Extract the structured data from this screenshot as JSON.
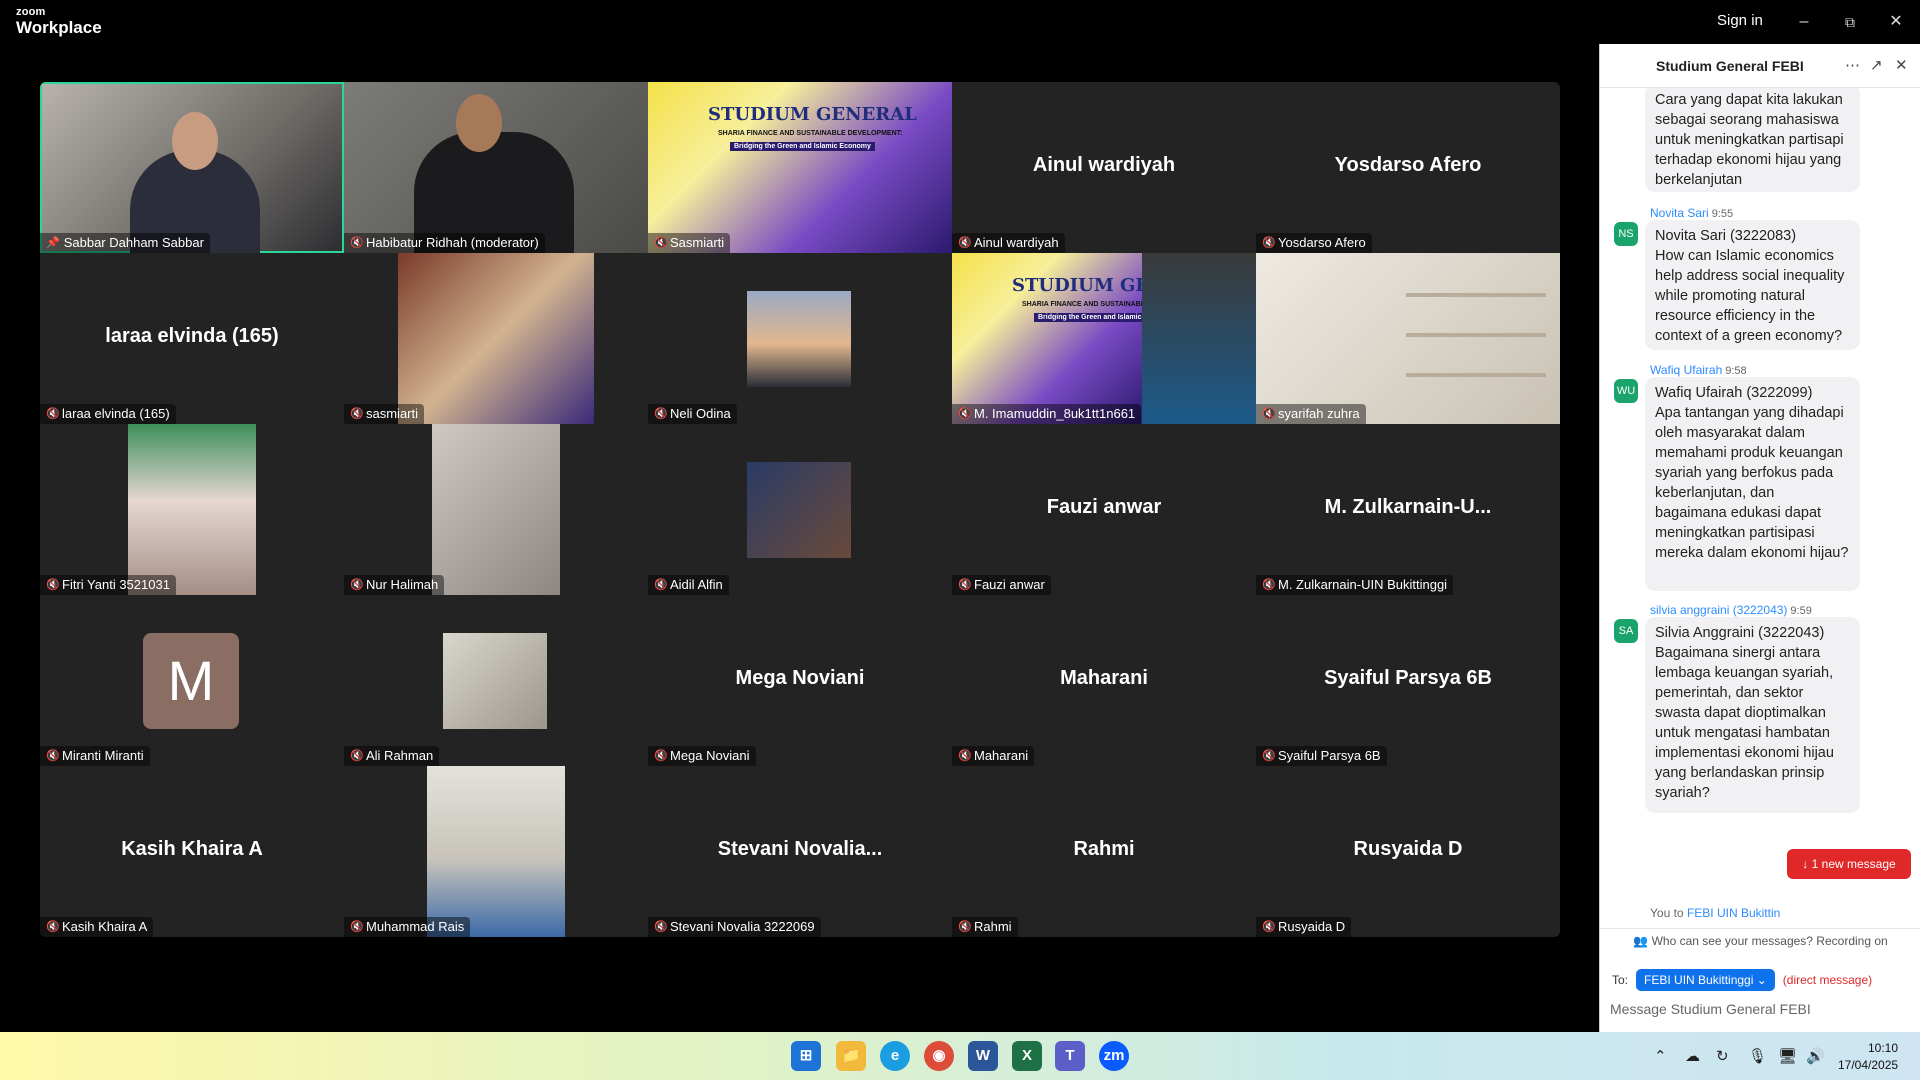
{
  "app": {
    "brand_top": "zoom",
    "brand_bottom": "Workplace",
    "signin": "Sign in"
  },
  "tiles": [
    {
      "name": "Sabbar Dahham Sabbar",
      "big": ""
    },
    {
      "name": "Habibatur Ridhah (moderator)",
      "big": ""
    },
    {
      "name": "Sasmiarti",
      "big": ""
    },
    {
      "name": "Ainul wardiyah",
      "big": "Ainul wardiyah"
    },
    {
      "name": "Yosdarso Afero",
      "big": "Yosdarso Afero"
    },
    {
      "name": "laraa elvinda (165)",
      "big": "laraa elvinda (165)"
    },
    {
      "name": "sasmiarti",
      "big": ""
    },
    {
      "name": "Neli Odina",
      "big": ""
    },
    {
      "name": "M. Imamuddin_8uk1tt1n661",
      "big": ""
    },
    {
      "name": "syarifah zuhra",
      "big": ""
    },
    {
      "name": "Fitri Yanti 3521031",
      "big": ""
    },
    {
      "name": "Nur Halimah",
      "big": ""
    },
    {
      "name": "Aidil Alfin",
      "big": ""
    },
    {
      "name": "Fauzi anwar",
      "big": "Fauzi anwar"
    },
    {
      "name": "M. Zulkarnain-UIN Bukittinggi",
      "big": "M.  Zulkarnain-U..."
    },
    {
      "name": "Miranti Miranti",
      "big": ""
    },
    {
      "name": "Ali Rahman",
      "big": ""
    },
    {
      "name": "Mega Noviani",
      "big": "Mega Noviani"
    },
    {
      "name": "Maharani",
      "big": "Maharani"
    },
    {
      "name": "Syaiful Parsya 6B",
      "big": "Syaiful Parsya 6B"
    },
    {
      "name": "Kasih Khaira A",
      "big": "Kasih Khaira A"
    },
    {
      "name": "Muhammad Rais",
      "big": ""
    },
    {
      "name": "Stevani Novalia 3222069",
      "big": "Stevani  Novalia..."
    },
    {
      "name": "Rahmi",
      "big": "Rahmi"
    },
    {
      "name": "Rusyaida D",
      "big": "Rusyaida D"
    }
  ],
  "avatar_letter": "M",
  "slide": {
    "title": "STUDIUM GENERAL",
    "subtitle": "SHARIA FINANCE AND SUSTAINABLE DEVELOPMENT:",
    "subtitle2": "Bridging the Green and Islamic Economy"
  },
  "chat": {
    "title": "Studium General FEBI",
    "first_bubble": "Cara yang dapat kita lakukan sebagai seorang mahasiswa untuk meningkatkan partisapi terhadap ekonomi hijau yang berkelanjutan",
    "messages": [
      {
        "initials": "NS",
        "sender": "Novita Sari",
        "time": "9:55",
        "text": "Novita Sari (3222083)\nHow can Islamic economics help address social inequality while promoting natural resource efficiency in the context of a green economy?"
      },
      {
        "initials": "WU",
        "sender": "Wafiq Ufairah",
        "time": "9:58",
        "text": "Wafiq Ufairah (3222099)\nApa tantangan yang dihadapi oleh masyarakat dalam memahami produk keuangan syariah yang berfokus pada keberlanjutan, dan bagaimana edukasi dapat meningkatkan partisipasi mereka dalam ekonomi hijau?"
      },
      {
        "initials": "SA",
        "sender": "silvia anggraini (3222043)",
        "time": "9:59",
        "text": "Silvia Anggraini (3222043)\nBagaimana sinergi antara lembaga keuangan syariah, pemerintah, dan sektor swasta dapat dioptimalkan untuk mengatasi hambatan implementasi ekonomi hijau yang berlandaskan prinsip syariah?"
      }
    ],
    "you_to": "You to",
    "you_to_target": "FEBI  UIN Bukittin",
    "new_message": "1 new message",
    "who_can_see": "Who can see your messages? Recording on",
    "to_label": "To:",
    "to_recipient": "FEBI  UIN Bukittinggi",
    "direct": "(direct message)",
    "placeholder": "Message Studium General FEBI"
  },
  "clock": {
    "time": "10:10",
    "date": "17/04/2025"
  }
}
